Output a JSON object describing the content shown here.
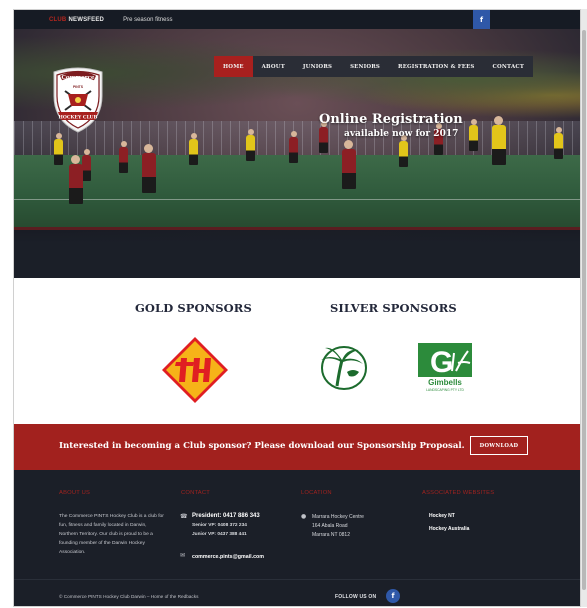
{
  "topbar": {
    "club_word": "CLUB",
    "newsfeed": "NEWSFEED",
    "ticker": "Pre season fitness",
    "facebook_glyph": "f"
  },
  "nav": {
    "items": [
      {
        "label": "HOME",
        "active": true
      },
      {
        "label": "ABOUT",
        "active": false
      },
      {
        "label": "JUNIORS",
        "active": false
      },
      {
        "label": "SENIORS",
        "active": false
      },
      {
        "label": "REGISTRATION & FEES",
        "active": false
      },
      {
        "label": "CONTACT",
        "active": false
      }
    ]
  },
  "logo": {
    "top_text": "Commerce",
    "mid_text": "PINTS",
    "bottom_text": "HOCKEY CLUB"
  },
  "hero": {
    "title": "Online Registration",
    "subtitle": "available now for 2017"
  },
  "sponsors": {
    "gold_heading": "GOLD SPONSORS",
    "silver_heading": "SILVER SPONSORS",
    "gimbells_name": "Gimbells",
    "gimbells_sub": "LANDSCAPING PTY LTD"
  },
  "cta": {
    "text": "Interested in becoming a Club sponsor? Please download our Sponsorship Proposal.",
    "button": "DOWNLOAD"
  },
  "footer": {
    "about_heading": "ABOUT US",
    "about_text": "The Commerce PINTS Hockey Club is a club for fun, fitness and family located in Darwin, Northern Territory. Our club is proud to be a founding member of the Darwin Hockey Association.",
    "contact_heading": "CONTACT",
    "president": "President: 0417 886 343",
    "senior_vp": "Senior VP: 0408 372 234",
    "junior_vp": "Junior VP: 0437 388 441",
    "email": "commerce.pints@gmail.com",
    "location_heading": "LOCATION",
    "location_lines": [
      "Marrara Hockey Centre",
      "164 Abala Road",
      "Marrara NT 0812"
    ],
    "websites_heading": "ASSOCIATED WEBSITES",
    "websites": [
      "Hockey NT",
      "Hockey Australia"
    ],
    "copyright": "© Commerce PINTS Hockey Club Darwin – Home of the Redbacks",
    "follow": "FOLLOW US ON",
    "facebook_glyph": "f"
  },
  "colors": {
    "brand_red": "#a2211e",
    "dark_navy": "#1b1f28",
    "facebook_blue": "#2f58a8"
  },
  "icons": {
    "phone": "phone-icon",
    "email": "email-icon",
    "location": "map-pin-icon"
  }
}
